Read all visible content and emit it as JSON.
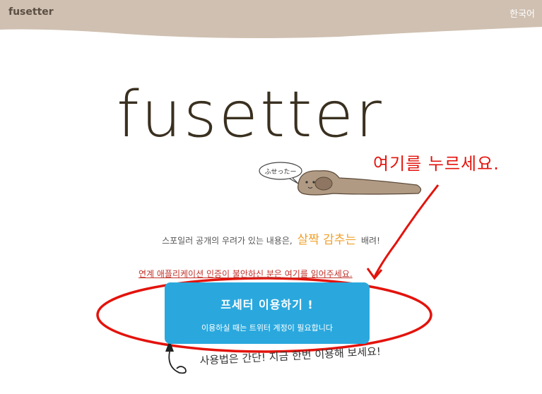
{
  "header": {
    "brand": "fusetter",
    "language": "한국어",
    "bg_color": "#cfc0b1"
  },
  "logo": {
    "text": "fusetter",
    "mascot_bubble": "ふせったー"
  },
  "annotation": {
    "text": "여기를 누르세요.",
    "color": "#e3130c"
  },
  "tagline": {
    "before": "스포일러 공개의 우려가 있는 내용은,",
    "highlight": "살짝 감추는",
    "after": "배려!"
  },
  "app_link": "연계 애플리케이션 인증이 불안하신 분은 여기를 읽어주세요.",
  "cta": {
    "title": "프세터 이용하기 !",
    "subtitle": "이용하실 때는 트위터 계정이 필요합니다",
    "color": "#2aa8de"
  },
  "howto": "사용법은 간단! 지금 한번 이용해 보세요!"
}
